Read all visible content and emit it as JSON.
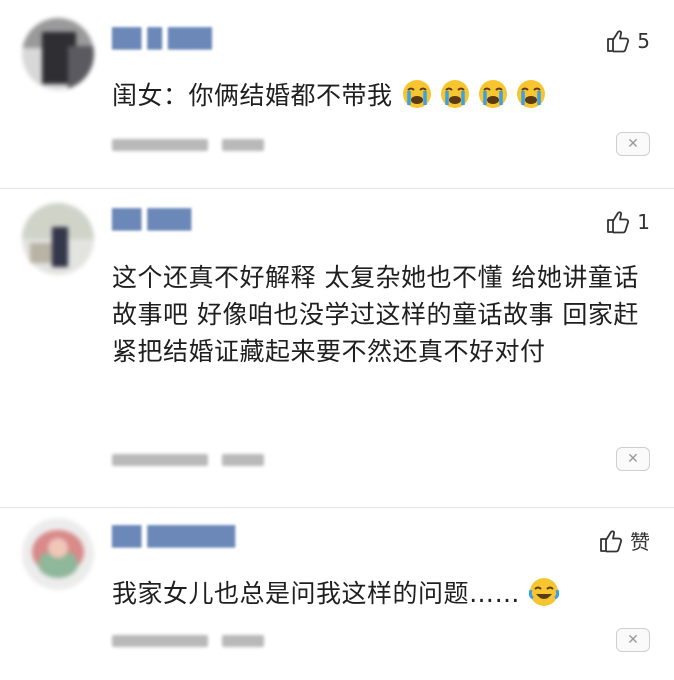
{
  "comments": [
    {
      "username": "██ █ ███",
      "likes": "5",
      "text": "闺女：你俩结婚都不带我",
      "emoji_count": 4,
      "emoji": "loudly-crying-face-icon",
      "close_label": "✕"
    },
    {
      "username": "██ ███",
      "likes": "1",
      "text": "这个还真不好解释 太复杂她也不懂 给她讲童话故事吧 好像咱也没学过这样的童话故事 回家赶紧把结婚证藏起来要不然还真不好对付",
      "close_label": "✕"
    },
    {
      "username": "██ ██████",
      "likes": "赞",
      "text": "我家女儿也总是问我这样的问题……",
      "emoji": "face-with-tears-of-joy-icon",
      "close_label": "✕"
    }
  ],
  "colors": {
    "username": "#6b88b8",
    "text": "#1f1f1f",
    "emoji_face": "#f7c530",
    "emoji_tear": "#3aa0e8"
  }
}
